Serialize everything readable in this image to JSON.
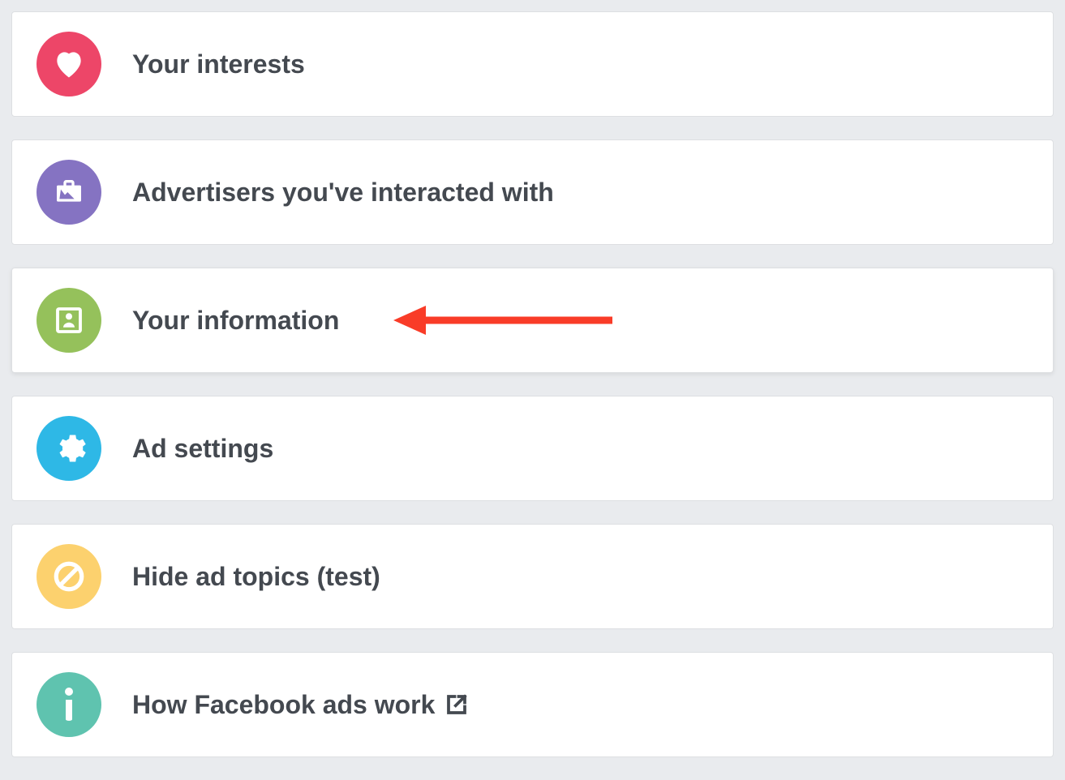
{
  "colors": {
    "heart": "#ed4668",
    "briefcase": "#8573c2",
    "profile": "#95c15b",
    "gear": "#2eb8e6",
    "prohibit": "#fcd16e",
    "info": "#5fc3af",
    "arrow": "#f93c28"
  },
  "settings_list": {
    "highlighted_index": 2,
    "items": [
      {
        "label": "Your interests",
        "icon": "heart-icon",
        "external": false
      },
      {
        "label": "Advertisers you've interacted with",
        "icon": "briefcase-icon",
        "external": false
      },
      {
        "label": "Your information",
        "icon": "profile-icon",
        "external": false
      },
      {
        "label": "Ad settings",
        "icon": "gear-icon",
        "external": false
      },
      {
        "label": "Hide ad topics (test)",
        "icon": "prohibit-icon",
        "external": false
      },
      {
        "label": "How Facebook ads work",
        "icon": "info-icon",
        "external": true
      }
    ]
  }
}
